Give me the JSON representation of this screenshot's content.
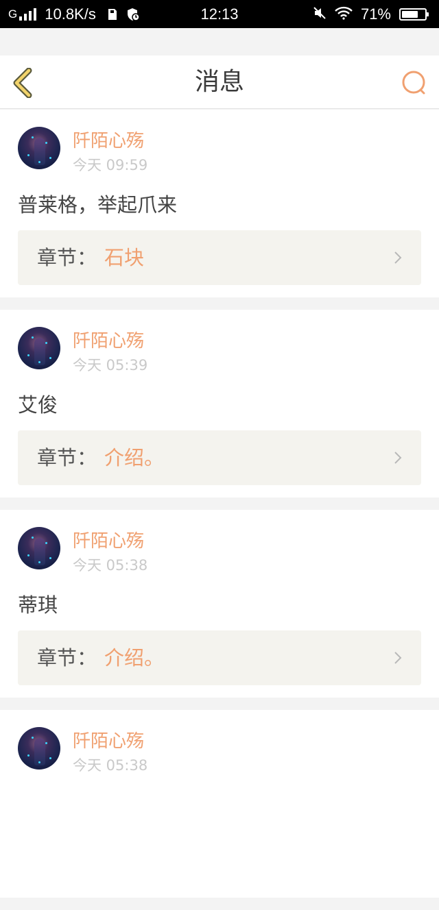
{
  "status_bar": {
    "network": "G",
    "speed": "10.8K/s",
    "time": "12:13",
    "battery": "71%",
    "battery_level": 0.71
  },
  "nav": {
    "title": "消息",
    "back_icon": "chevron-left-icon",
    "search_icon": "search-icon"
  },
  "colors": {
    "accent": "#f0a070",
    "back_arrow": "#f2d36b",
    "chapter_bg": "#f4f3ee",
    "page_bg": "#f3f3f3"
  },
  "messages": [
    {
      "author": "阡陌心殇",
      "time": "今天 09:59",
      "text": "普莱格，举起爪来",
      "chapter_label": "章节：",
      "chapter_name": "石块"
    },
    {
      "author": "阡陌心殇",
      "time": "今天 05:39",
      "text": "艾俊",
      "chapter_label": "章节：",
      "chapter_name": "介绍。"
    },
    {
      "author": "阡陌心殇",
      "time": "今天 05:38",
      "text": "蒂琪",
      "chapter_label": "章节：",
      "chapter_name": "介绍。"
    },
    {
      "author": "阡陌心殇",
      "time": "今天 05:38"
    }
  ]
}
